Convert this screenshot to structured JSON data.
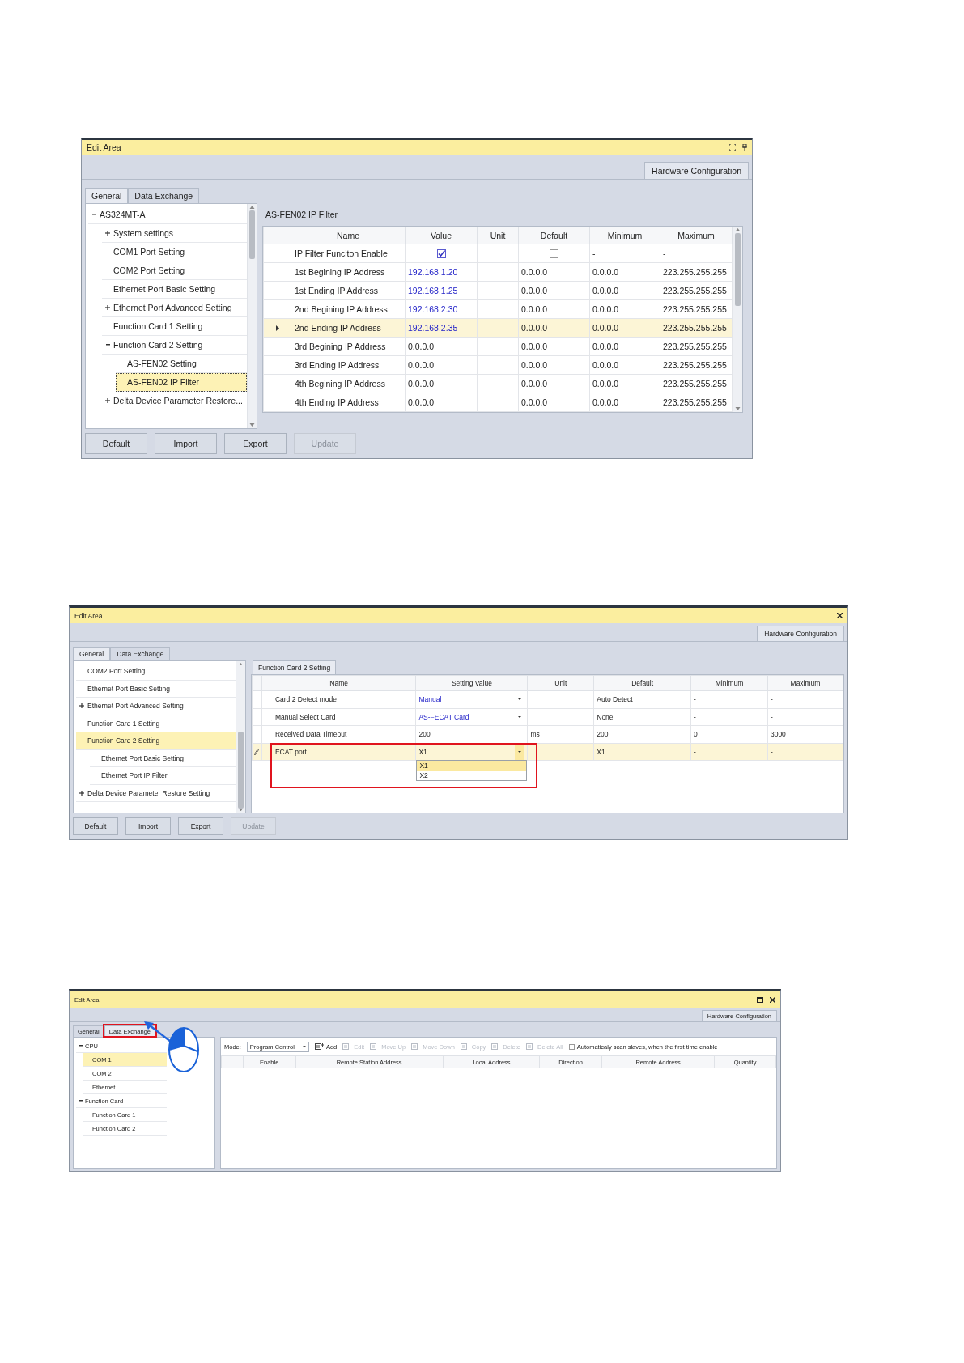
{
  "windows": [
    {
      "kind": "parameters",
      "title": "Edit Area",
      "title_buttons": [
        {
          "kind": "float"
        },
        {
          "kind": "pin"
        }
      ],
      "doc_tab": "Hardware Configuration",
      "tabs": [
        {
          "label": "General",
          "selected": true
        },
        {
          "label": "Data Exchange",
          "selected": false
        }
      ],
      "tree": [
        {
          "label": "AS324MT-A",
          "expanded": true,
          "selected": false,
          "children": [
            {
              "label": "System settings",
              "expanded": false,
              "selected": false
            },
            {
              "label": "COM1 Port Setting",
              "selected": false
            },
            {
              "label": "COM2 Port Setting",
              "selected": false
            },
            {
              "label": "Ethernet Port Basic Setting",
              "selected": false
            },
            {
              "label": "Ethernet Port Advanced Setting",
              "expanded": false,
              "selected": false
            },
            {
              "label": "Function Card 1 Setting",
              "selected": false
            },
            {
              "label": "Function Card 2 Setting",
              "expanded": true,
              "selected": false,
              "children": [
                {
                  "label": "AS-FEN02 Setting",
                  "selected": false
                },
                {
                  "label": "AS-FEN02 IP Filter",
                  "selected": true
                }
              ]
            },
            {
              "label": "Delta Device Parameter Restore...",
              "expanded": false,
              "selected": false
            }
          ]
        }
      ],
      "panel": {
        "kind": "caption",
        "label": "AS-FEN02 IP Filter"
      },
      "columns": [
        "Name",
        "Value",
        "Unit",
        "Default",
        "Minimum",
        "Maximum"
      ],
      "rows": [
        {
          "kind": "checkbox",
          "name": "IP Filter Funciton Enable",
          "value": {
            "checked": true
          },
          "default": {
            "checked": false
          },
          "minimum": "-",
          "maximum": "-",
          "selected": false
        },
        {
          "kind": "text",
          "name": "1st Begining IP Address",
          "value": "192.168.1.20",
          "modified": true,
          "default": "0.0.0.0",
          "minimum": "0.0.0.0",
          "maximum": "223.255.255.255",
          "selected": false
        },
        {
          "kind": "text",
          "name": "1st Ending IP Address",
          "value": "192.168.1.25",
          "modified": true,
          "default": "0.0.0.0",
          "minimum": "0.0.0.0",
          "maximum": "223.255.255.255",
          "selected": false
        },
        {
          "kind": "text",
          "name": "2nd Begining IP Address",
          "value": "192.168.2.30",
          "modified": true,
          "default": "0.0.0.0",
          "minimum": "0.0.0.0",
          "maximum": "223.255.255.255",
          "selected": false
        },
        {
          "kind": "text",
          "name": "2nd Ending IP Address",
          "value": "192.168.2.35",
          "modified": true,
          "default": "0.0.0.0",
          "minimum": "0.0.0.0",
          "maximum": "223.255.255.255",
          "selected": true
        },
        {
          "kind": "text",
          "name": "3rd Begining IP Address",
          "value": "0.0.0.0",
          "modified": false,
          "default": "0.0.0.0",
          "minimum": "0.0.0.0",
          "maximum": "223.255.255.255",
          "selected": false
        },
        {
          "kind": "text",
          "name": "3rd Ending IP Address",
          "value": "0.0.0.0",
          "modified": false,
          "default": "0.0.0.0",
          "minimum": "0.0.0.0",
          "maximum": "223.255.255.255",
          "selected": false
        },
        {
          "kind": "text",
          "name": "4th Begining IP Address",
          "value": "0.0.0.0",
          "modified": false,
          "default": "0.0.0.0",
          "minimum": "0.0.0.0",
          "maximum": "223.255.255.255",
          "selected": false
        },
        {
          "kind": "text",
          "name": "4th Ending IP Address",
          "value": "0.0.0.0",
          "modified": false,
          "default": "0.0.0.0",
          "minimum": "0.0.0.0",
          "maximum": "223.255.255.255",
          "selected": false
        }
      ],
      "buttons": [
        {
          "label": "Default",
          "disabled": false
        },
        {
          "label": "Import",
          "disabled": false
        },
        {
          "label": "Export",
          "disabled": false
        },
        {
          "label": "Update",
          "disabled": true
        }
      ]
    },
    {
      "kind": "parameters",
      "title": "Edit Area",
      "title_buttons": [
        {
          "kind": "close"
        }
      ],
      "doc_tab": "Hardware Configuration",
      "tabs": [
        {
          "label": "General",
          "selected": true
        },
        {
          "label": "Data Exchange",
          "selected": false
        }
      ],
      "tree": [
        {
          "label": "COM2 Port Setting",
          "selected": false
        },
        {
          "label": "Ethernet Port Basic Setting",
          "selected": false
        },
        {
          "label": "Ethernet Port Advanced Setting",
          "expanded": false,
          "selected": false
        },
        {
          "label": "Function Card 1 Setting",
          "selected": false
        },
        {
          "label": "Function Card 2 Setting",
          "expanded": true,
          "selected": true,
          "children": [
            {
              "label": "Ethernet Port Basic Setting",
              "selected": false
            },
            {
              "label": "Ethernet Port IP Filter",
              "selected": false
            }
          ]
        },
        {
          "label": "Delta Device Parameter Restore Setting",
          "expanded": false,
          "selected": false
        }
      ],
      "panel": {
        "kind": "tab",
        "label": "Function Card 2 Setting"
      },
      "columns": [
        "Name",
        "Setting Value",
        "Unit",
        "Default",
        "Minimum",
        "Maximum"
      ],
      "rows": [
        {
          "kind": "dropdown",
          "name": "Card 2 Detect mode",
          "value": "Manual",
          "modified": true,
          "default": "Auto Detect",
          "minimum": "-",
          "maximum": "-",
          "selected": false
        },
        {
          "kind": "dropdown",
          "name": "Manual Select Card",
          "value": "AS-FECAT Card",
          "modified": true,
          "default": "None",
          "minimum": "-",
          "maximum": "-",
          "selected": false
        },
        {
          "kind": "text",
          "name": "Received Data Timeout",
          "value": "200",
          "modified": false,
          "unit": "ms",
          "default": "200",
          "minimum": "0",
          "maximum": "3000",
          "selected": false
        },
        {
          "kind": "dropdown",
          "name": "ECAT port",
          "value": "X1",
          "modified": false,
          "editing": true,
          "options": [
            {
              "label": "X1",
              "selected": true
            },
            {
              "label": "X2",
              "selected": false
            }
          ],
          "default": "X1",
          "minimum": "-",
          "maximum": "-",
          "selected": true
        }
      ],
      "buttons": [
        {
          "label": "Default",
          "disabled": false
        },
        {
          "label": "Import",
          "disabled": false
        },
        {
          "label": "Export",
          "disabled": false
        },
        {
          "label": "Update",
          "disabled": true
        }
      ]
    },
    {
      "kind": "data_exchange",
      "title": "Edit Area",
      "title_buttons": [
        {
          "kind": "maximize"
        },
        {
          "kind": "close"
        }
      ],
      "doc_tab": "Hardware Configuration",
      "tabs": [
        {
          "label": "General",
          "selected": false
        },
        {
          "label": "Data Exchange",
          "selected": true
        }
      ],
      "tree": [
        {
          "label": "CPU",
          "expanded": true,
          "selected": false,
          "children": [
            {
              "label": "COM 1",
              "selected": true
            },
            {
              "label": "COM 2",
              "selected": false
            },
            {
              "label": "Ethernet",
              "selected": false
            }
          ]
        },
        {
          "label": "Function Card",
          "expanded": true,
          "selected": false,
          "children": [
            {
              "label": "Function Card 1",
              "selected": false
            },
            {
              "label": "Function Card 2",
              "selected": false
            }
          ]
        }
      ],
      "mode_label": "Mode:",
      "mode": "Program Control",
      "tools": [
        {
          "label": "Add",
          "disabled": false
        },
        {
          "label": "Edit",
          "disabled": true
        },
        {
          "label": "Move Up",
          "disabled": true
        },
        {
          "label": "Move Down",
          "disabled": true
        },
        {
          "label": "Copy",
          "disabled": true
        },
        {
          "label": "Delete",
          "disabled": true
        },
        {
          "label": "Delete All",
          "disabled": true
        }
      ],
      "auto_scan": {
        "label": "Automaticaly scan slaves, when the first time enable",
        "checked": false
      },
      "columns": [
        "Enable",
        "Remote Station Address",
        "Local Address",
        "Direction",
        "Remote Address",
        "Quantity"
      ]
    }
  ]
}
